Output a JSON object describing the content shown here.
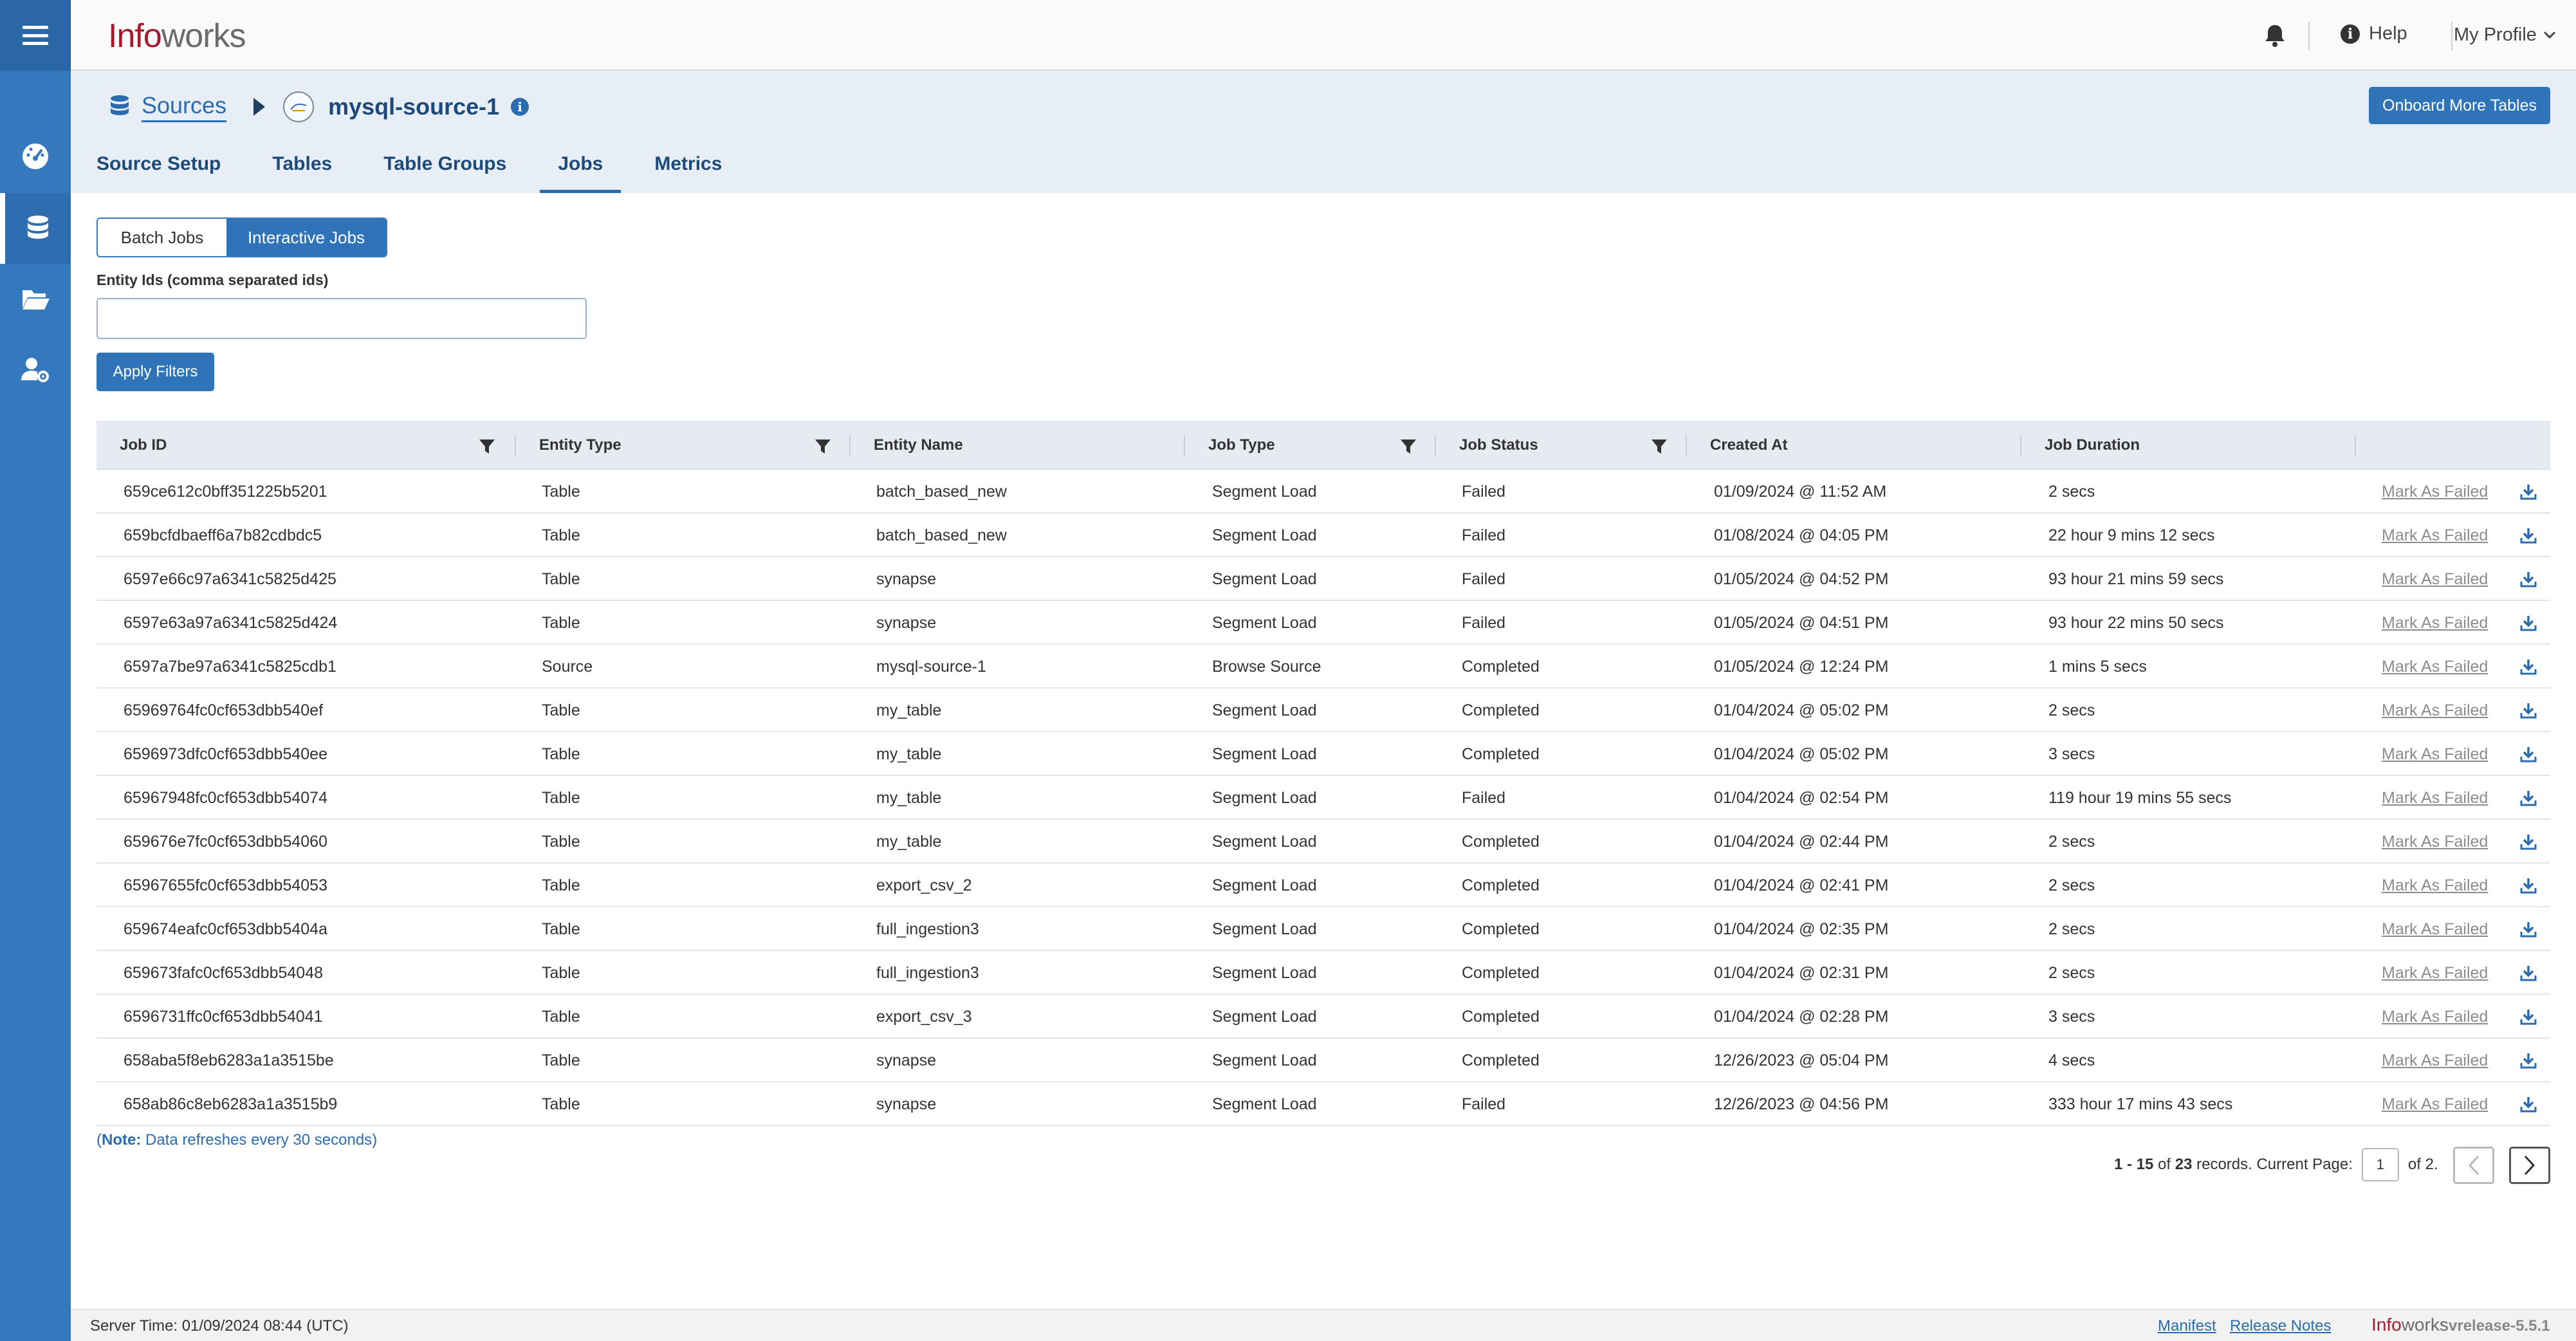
{
  "app": {
    "logo_part1": "Info",
    "logo_part2": "works",
    "help_label": "Help",
    "profile_label": "My Profile"
  },
  "breadcrumb": {
    "root": "Sources",
    "current": "mysql-source-1"
  },
  "actions": {
    "onboard_label": "Onboard More Tables"
  },
  "tabs": [
    {
      "label": "Source Setup",
      "active": false
    },
    {
      "label": "Tables",
      "active": false
    },
    {
      "label": "Table Groups",
      "active": false
    },
    {
      "label": "Jobs",
      "active": true
    },
    {
      "label": "Metrics",
      "active": false
    }
  ],
  "job_toggle": {
    "batch_label": "Batch Jobs",
    "interactive_label": "Interactive Jobs",
    "selected": "Interactive Jobs"
  },
  "filters": {
    "entity_ids_label": "Entity Ids (comma separated ids)",
    "entity_ids_value": "",
    "apply_label": "Apply Filters"
  },
  "table": {
    "columns": [
      "Job ID",
      "Entity Type",
      "Entity Name",
      "Job Type",
      "Job Status",
      "Created At",
      "Job Duration"
    ],
    "action_label": "Mark As Failed",
    "rows": [
      [
        "659ce612c0bff351225b5201",
        "Table",
        "batch_based_new",
        "Segment Load",
        "Failed",
        "01/09/2024 @ 11:52 AM",
        "2 secs"
      ],
      [
        "659bcfdbaeff6a7b82cdbdc5",
        "Table",
        "batch_based_new",
        "Segment Load",
        "Failed",
        "01/08/2024 @ 04:05 PM",
        "22 hour 9 mins 12 secs"
      ],
      [
        "6597e66c97a6341c5825d425",
        "Table",
        "synapse",
        "Segment Load",
        "Failed",
        "01/05/2024 @ 04:52 PM",
        "93 hour 21 mins 59 secs"
      ],
      [
        "6597e63a97a6341c5825d424",
        "Table",
        "synapse",
        "Segment Load",
        "Failed",
        "01/05/2024 @ 04:51 PM",
        "93 hour 22 mins 50 secs"
      ],
      [
        "6597a7be97a6341c5825cdb1",
        "Source",
        "mysql-source-1",
        "Browse Source",
        "Completed",
        "01/05/2024 @ 12:24 PM",
        "1 mins 5 secs"
      ],
      [
        "65969764fc0cf653dbb540ef",
        "Table",
        "my_table",
        "Segment Load",
        "Completed",
        "01/04/2024 @ 05:02 PM",
        "2 secs"
      ],
      [
        "6596973dfc0cf653dbb540ee",
        "Table",
        "my_table",
        "Segment Load",
        "Completed",
        "01/04/2024 @ 05:02 PM",
        "3 secs"
      ],
      [
        "65967948fc0cf653dbb54074",
        "Table",
        "my_table",
        "Segment Load",
        "Failed",
        "01/04/2024 @ 02:54 PM",
        "119 hour 19 mins 55 secs"
      ],
      [
        "659676e7fc0cf653dbb54060",
        "Table",
        "my_table",
        "Segment Load",
        "Completed",
        "01/04/2024 @ 02:44 PM",
        "2 secs"
      ],
      [
        "65967655fc0cf653dbb54053",
        "Table",
        "export_csv_2",
        "Segment Load",
        "Completed",
        "01/04/2024 @ 02:41 PM",
        "2 secs"
      ],
      [
        "659674eafc0cf653dbb5404a",
        "Table",
        "full_ingestion3",
        "Segment Load",
        "Completed",
        "01/04/2024 @ 02:35 PM",
        "2 secs"
      ],
      [
        "659673fafc0cf653dbb54048",
        "Table",
        "full_ingestion3",
        "Segment Load",
        "Completed",
        "01/04/2024 @ 02:31 PM",
        "2 secs"
      ],
      [
        "6596731ffc0cf653dbb54041",
        "Table",
        "export_csv_3",
        "Segment Load",
        "Completed",
        "01/04/2024 @ 02:28 PM",
        "3 secs"
      ],
      [
        "658aba5f8eb6283a1a3515be",
        "Table",
        "synapse",
        "Segment Load",
        "Completed",
        "12/26/2023 @ 05:04 PM",
        "4 secs"
      ],
      [
        "658ab86c8eb6283a1a3515b9",
        "Table",
        "synapse",
        "Segment Load",
        "Failed",
        "12/26/2023 @ 04:56 PM",
        "333 hour 17 mins 43 secs"
      ]
    ]
  },
  "note": {
    "prefix": "Note:",
    "text": "Data refreshes every 30 seconds"
  },
  "pagination": {
    "range": "1 - 15",
    "of": "of",
    "total": "23",
    "records_text": "records. Current Page:",
    "current_page": "1",
    "of_pages": "of 2."
  },
  "footer": {
    "server_time": "Server Time: 01/09/2024 08:44 (UTC)",
    "manifest": "Manifest",
    "release_notes": "Release Notes",
    "brand_part1": "Info",
    "brand_part2": "works",
    "version": "vrelease-5.5.1"
  },
  "colors": {
    "rail": "#3478bd",
    "accent": "#2f73b8",
    "brand_red": "#a6192e"
  },
  "icons": [
    "hamburger-icon",
    "dashboard-icon",
    "database-icon",
    "folder-open-icon",
    "user-settings-icon",
    "bell-icon",
    "info-icon",
    "chevron-down-icon",
    "filter-icon",
    "download-icon",
    "chevron-left-icon",
    "chevron-right-icon"
  ]
}
